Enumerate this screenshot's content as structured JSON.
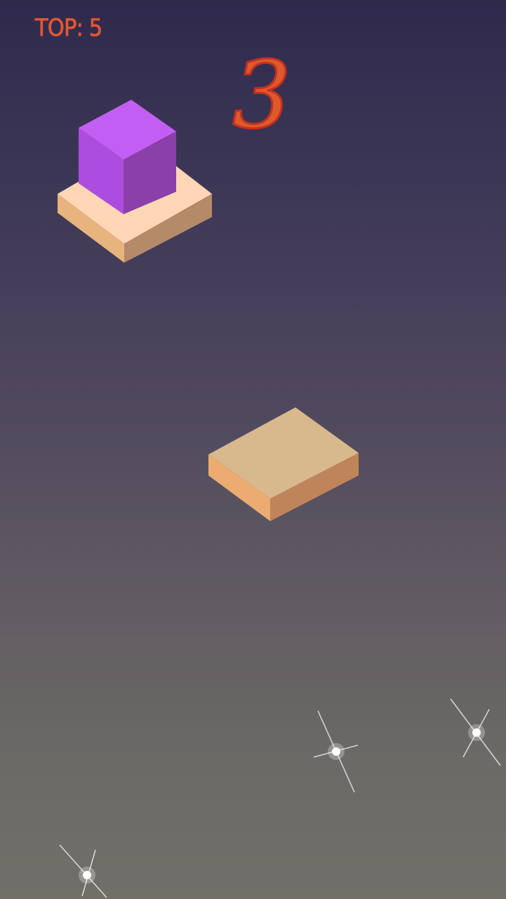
{
  "hud": {
    "top_label": "TOP: 5",
    "score": "3"
  },
  "colors": {
    "score": "#de5a2c",
    "cube_top": "#c35ef3",
    "cube_left": "#ac4ddf",
    "cube_right": "#8a3fa9",
    "platform_top_current": "#ffd7b6",
    "platform_left_current": "#e8b47d",
    "platform_right_current": "#b48a69",
    "platform_top_next": "#d8b98d",
    "platform_left_next": "#ecab70",
    "platform_right_next": "#c0845a"
  }
}
